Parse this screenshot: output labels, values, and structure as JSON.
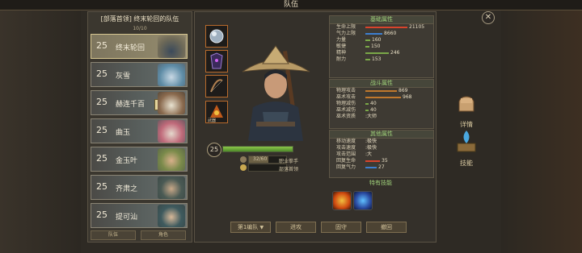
{
  "window": {
    "title": "队伍"
  },
  "team": {
    "header": "[部落首领] 终末轮回的队伍",
    "count": "10/10",
    "members": [
      {
        "level": "25",
        "name": "终末轮回",
        "selected": true
      },
      {
        "level": "25",
        "name": "灰雪",
        "selected": false
      },
      {
        "level": "25",
        "name": "赫连千百",
        "selected": false
      },
      {
        "level": "25",
        "name": "曲玉",
        "selected": false
      },
      {
        "level": "25",
        "name": "金玉叶",
        "selected": false
      },
      {
        "level": "25",
        "name": "齐肃之",
        "selected": false
      },
      {
        "level": "25",
        "name": "提可汕",
        "selected": false
      }
    ],
    "footer_left": "队伍",
    "footer_right": "角色"
  },
  "hero": {
    "level": "25",
    "exp": "32/60",
    "class_label": "职业拳手",
    "title_label": "部落首领",
    "equip_label": "武器"
  },
  "basic_attrs": {
    "title": "基础属性",
    "rows": [
      {
        "label": "生命上限",
        "value": "21105",
        "color": "#d8442c",
        "fill": 1.0
      },
      {
        "label": "气力上限",
        "value": "8660",
        "color": "#3d7fd0",
        "fill": 0.41
      },
      {
        "label": "力量",
        "value": "160",
        "color": "#7aa848",
        "fill": 0.11
      },
      {
        "label": "敏捷",
        "value": "150",
        "color": "#7aa848",
        "fill": 0.1
      },
      {
        "label": "精神",
        "value": "246",
        "color": "#7aa848",
        "fill": 0.55
      },
      {
        "label": "耐力",
        "value": "153",
        "color": "#7aa848",
        "fill": 0.12
      }
    ]
  },
  "combat_attrs": {
    "title": "战斗属性",
    "rows": [
      {
        "label": "物理攻击",
        "value": "869",
        "color": "#c0782c",
        "fill": 0.75
      },
      {
        "label": "巫术攻击",
        "value": "968",
        "color": "#c0782c",
        "fill": 0.84
      },
      {
        "label": "物理减伤",
        "value": "40",
        "color": "#7aa848",
        "fill": 0.08
      },
      {
        "label": "巫术减伤",
        "value": "40",
        "color": "#7aa848",
        "fill": 0.08
      }
    ],
    "special_label": "巫术资质",
    "special_value": ":大师"
  },
  "other_attrs": {
    "title": "其他属性",
    "speed_rows": [
      {
        "label": "移动速度",
        "value": ":极快"
      },
      {
        "label": "攻击速度",
        "value": ":极快"
      },
      {
        "label": "攻击范围",
        "value": ":大"
      }
    ],
    "regen_rows": [
      {
        "label": "回复生命",
        "value": "35",
        "color": "#d8442c",
        "fill": 0.35
      },
      {
        "label": "回复气力",
        "value": "27",
        "color": "#3d7fd0",
        "fill": 0.27
      }
    ]
  },
  "skills": {
    "title": "特有技能"
  },
  "bottom_buttons": {
    "formation": "第1编队",
    "attack": "进攻",
    "defend": "固守",
    "retreat": "撤回"
  },
  "side_tabs": {
    "detail": "详情",
    "skill": "技能"
  }
}
